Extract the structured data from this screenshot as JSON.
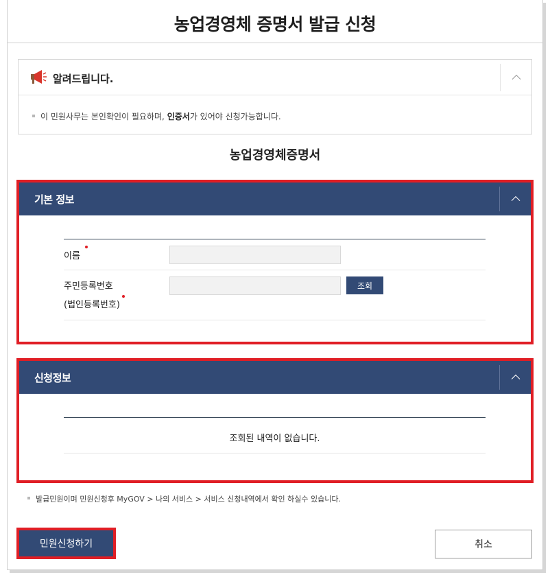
{
  "page": {
    "title": "농업경영체 증명서 발급 신청"
  },
  "notice": {
    "title": "알려드립니다.",
    "text_before": "이 민원사무는 본인확인이 필요하며, ",
    "text_bold": "인증서",
    "text_after": "가 있어야 신청가능합니다."
  },
  "certificate_heading": "농업경영체증명서",
  "basic_info": {
    "title": "기본 정보",
    "name_label": "이름",
    "name_value": "",
    "id_label_line1": "주민등록번호",
    "id_label_line2": "(법인등록번호)",
    "id_value": "",
    "search_button": "조회"
  },
  "application_info": {
    "title": "신청정보",
    "empty_message": "조회된 내역이 없습니다."
  },
  "footnote": "발급민원이며 민원신청후 MyGOV > 나의 서비스 > 서비스 신청내역에서 확인 하실수 있습니다.",
  "actions": {
    "submit_label": "민원신청하기",
    "cancel_label": "취소"
  },
  "colors": {
    "panel_header": "#324a75",
    "highlight": "#e01e25",
    "required_dot": "#e01e25"
  }
}
